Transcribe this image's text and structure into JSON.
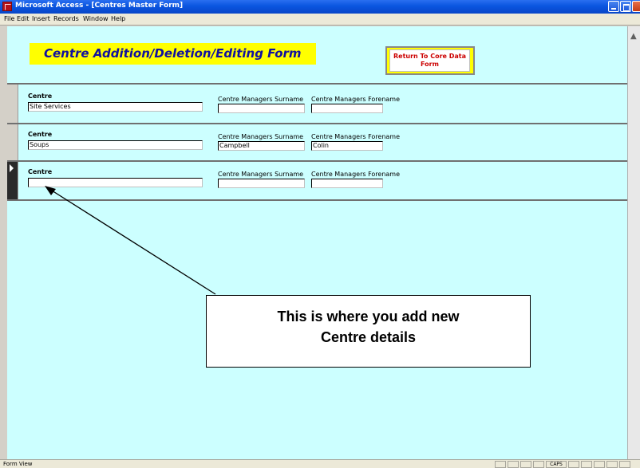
{
  "window": {
    "title": "Microsoft Access - [Centres Master Form]"
  },
  "menu": {
    "items": [
      "File",
      "Edit",
      "Insert",
      "Records",
      "Window",
      "Help"
    ]
  },
  "form": {
    "header_title": "Centre Addition/Deletion/Editing Form",
    "return_button_label": "Return To Core Data Form",
    "records": [
      {
        "centre_label": "Centre",
        "centre": "Site Services",
        "surname_label": "Centre Managers Surname",
        "surname": "",
        "forename_label": "Centre Managers Forename",
        "forename": ""
      },
      {
        "centre_label": "Centre",
        "centre": "Soups",
        "surname_label": "Centre Managers Surname",
        "surname": "Campbell",
        "forename_label": "Centre Managers Forename",
        "forename": "Colin"
      },
      {
        "centre_label": "Centre",
        "centre": "",
        "surname_label": "Centre Managers Surname",
        "surname": "",
        "forename_label": "Centre Managers Forename",
        "forename": ""
      }
    ]
  },
  "annotation": {
    "line1": "This is where you add new",
    "line2": "Centre details"
  },
  "status": {
    "view": "Form View",
    "caps": "CAPS"
  },
  "colors": {
    "form_background": "#ccffff",
    "banner_yellow": "#ffff00",
    "title_blue": "#1010a0",
    "button_text_red": "#cc0000"
  },
  "icons": {
    "app": "access-app-icon",
    "minimize": "minimize-icon",
    "maximize": "maximize-icon",
    "close": "close-icon",
    "record_selector": "current-record-arrow-icon"
  }
}
